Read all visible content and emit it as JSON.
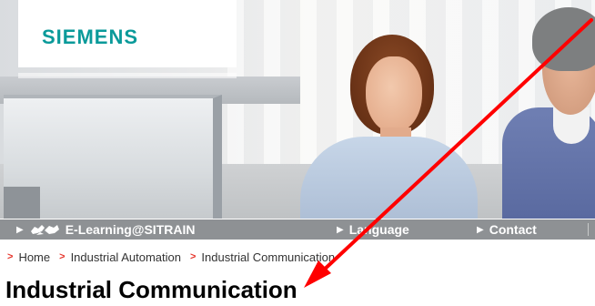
{
  "brand": {
    "logo_text": "SIEMENS",
    "logo_color": "#0a9a9a"
  },
  "hero": {
    "description_icon": "photo-two-people-at-monitor"
  },
  "nav": {
    "background": "#8e9194",
    "items": [
      {
        "label": "E-Learning@SITRAIN",
        "icon": "globe-network-icon"
      },
      {
        "label": "Language"
      },
      {
        "label": "Contact"
      }
    ]
  },
  "breadcrumb": {
    "arrow_color": "#e6352b",
    "items": [
      {
        "label": "Home"
      },
      {
        "label": "Industrial Automation"
      },
      {
        "label": "Industrial Communication"
      }
    ]
  },
  "page": {
    "title": "Industrial Communication"
  },
  "annotation": {
    "type": "arrow",
    "color": "#ff0000"
  }
}
